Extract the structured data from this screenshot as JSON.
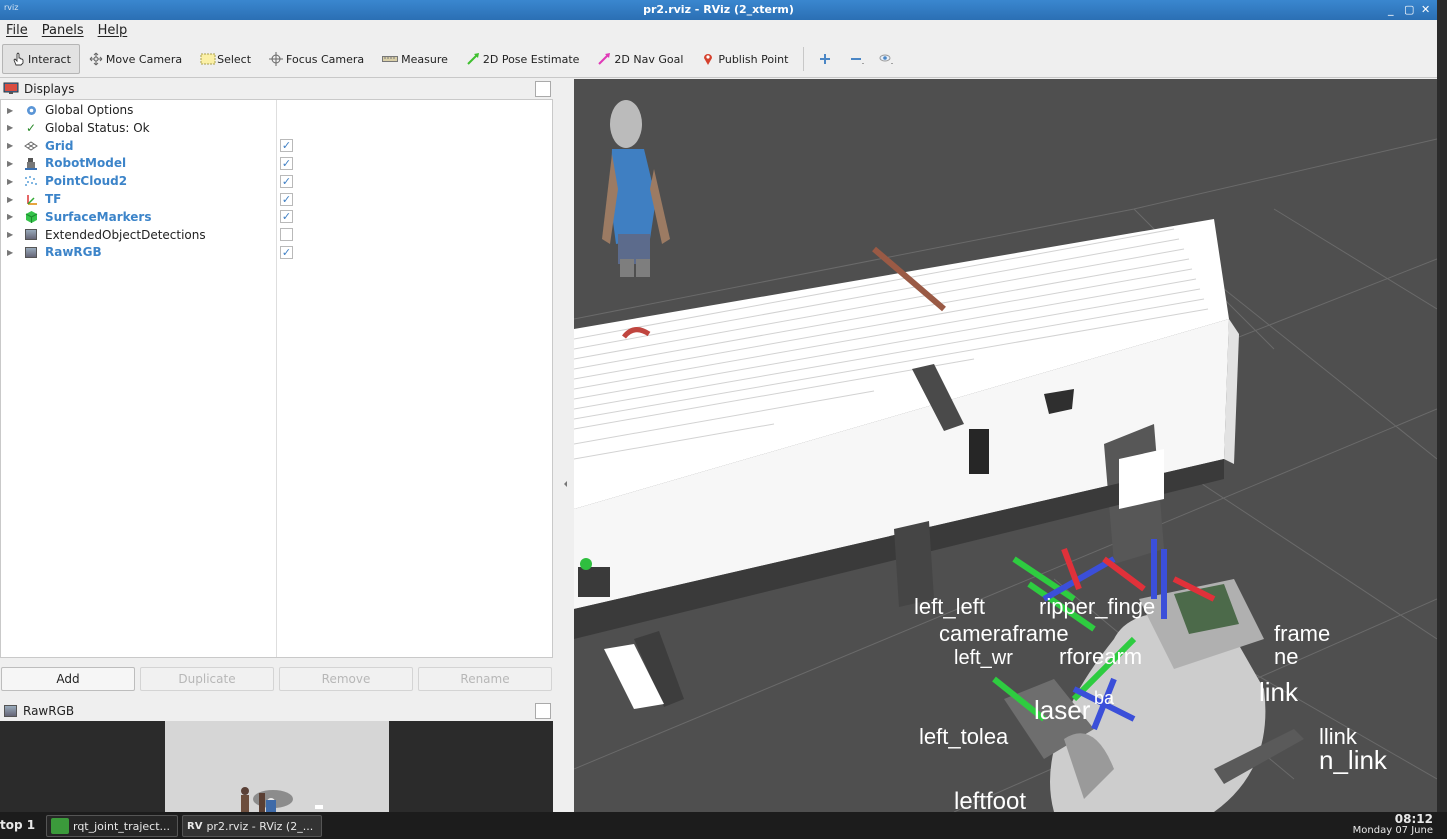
{
  "window": {
    "app_glyph": "rviz",
    "title": "pr2.rviz - RViz (2_xterm)",
    "controls": [
      "_",
      "▢",
      "✕"
    ]
  },
  "menu": [
    "File",
    "Panels",
    "Help"
  ],
  "toolbar": {
    "tools": [
      {
        "label": "Interact",
        "icon": "hand-cursor-icon",
        "active": true
      },
      {
        "label": "Move Camera",
        "icon": "move-arrows-icon"
      },
      {
        "label": "Select",
        "icon": "select-box-icon"
      },
      {
        "label": "Focus Camera",
        "icon": "focus-target-icon"
      },
      {
        "label": "Measure",
        "icon": "ruler-icon"
      },
      {
        "label": "2D Pose Estimate",
        "icon": "green-arrow-icon"
      },
      {
        "label": "2D Nav Goal",
        "icon": "pink-arrow-icon"
      },
      {
        "label": "Publish Point",
        "icon": "map-pin-icon"
      }
    ],
    "view_icons": [
      "plus-icon",
      "minus-icon",
      "eye-icon"
    ]
  },
  "displays": {
    "title": "Displays",
    "items": [
      {
        "label": "Global Options",
        "icon": "gear-icon",
        "bold": false,
        "checkbox": null
      },
      {
        "label": "Global Status: Ok",
        "icon": "check-icon",
        "bold": false,
        "checkbox": null
      },
      {
        "label": "Grid",
        "icon": "grid-icon",
        "bold": true,
        "checkbox": true
      },
      {
        "label": "RobotModel",
        "icon": "robot-icon",
        "bold": true,
        "checkbox": true
      },
      {
        "label": "PointCloud2",
        "icon": "pointcloud-icon",
        "bold": true,
        "checkbox": true
      },
      {
        "label": "TF",
        "icon": "axes-icon",
        "bold": true,
        "checkbox": true
      },
      {
        "label": "SurfaceMarkers",
        "icon": "cube-icon",
        "bold": true,
        "checkbox": true
      },
      {
        "label": "ExtendedObjectDetections",
        "icon": "image-icon",
        "bold": false,
        "checkbox": false
      },
      {
        "label": "RawRGB",
        "icon": "image-icon",
        "bold": true,
        "checkbox": true
      }
    ]
  },
  "buttons": {
    "add": "Add",
    "duplicate": "Duplicate",
    "remove": "Remove",
    "rename": "Rename"
  },
  "rawrgb": {
    "title": "RawRGB"
  },
  "viewport": {
    "labels": [
      "left_left",
      "ripper_finge",
      "cameraframe",
      "frame",
      "left_wr",
      "rforearm",
      "ne",
      "link",
      "laser",
      "ba",
      "left_tolea",
      "llink",
      "n_link",
      "leftfoot"
    ]
  },
  "taskbar": {
    "desktop": "top 1",
    "tasks": [
      {
        "label": "rqt_joint_traject...",
        "icon": "rqt-icon"
      },
      {
        "label": "pr2.rviz - RViz (2_...",
        "icon": "rviz-icon"
      }
    ],
    "clock_time": "08:12",
    "clock_date": "Monday 07 June"
  }
}
